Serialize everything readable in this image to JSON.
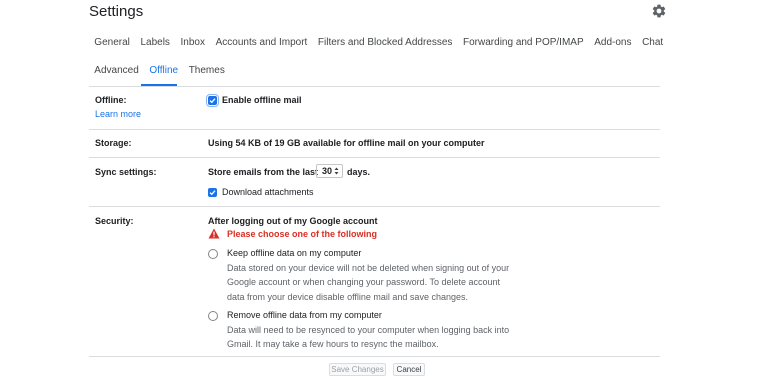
{
  "page": {
    "title": "Settings"
  },
  "tabs_row1": [
    "General",
    "Labels",
    "Inbox",
    "Accounts and Import",
    "Filters and Blocked Addresses",
    "Forwarding and POP/IMAP",
    "Add-ons",
    "Chat"
  ],
  "tabs_row2": [
    "Advanced",
    "Offline",
    "Themes"
  ],
  "active_tab": "Offline",
  "offline": {
    "label": "Offline:",
    "learn_more": "Learn more",
    "enable_label": "Enable offline mail",
    "enable_checked": true
  },
  "storage": {
    "label": "Storage:",
    "text": "Using 54 KB of 19 GB available for offline mail on your computer"
  },
  "sync": {
    "label": "Sync settings:",
    "prefix": "Store emails from the last",
    "days_value": "30",
    "suffix": "days.",
    "download_label": "Download attachments",
    "download_checked": true
  },
  "security": {
    "label": "Security:",
    "heading": "After logging out of my Google account",
    "warning": "Please choose one of the following",
    "option_keep": {
      "label": "Keep offline data on my computer",
      "desc": [
        "Data stored on your device will not be deleted when signing out of your",
        "Google account or when changing your password. To delete account",
        "data from your device disable offline mail and save changes."
      ]
    },
    "option_remove": {
      "label": "Remove offline data from my computer",
      "desc": [
        "Data will need to be resynced to your computer when logging back into",
        "Gmail. It may take a few hours to resync the mailbox."
      ]
    }
  },
  "buttons": {
    "save": "Save Changes",
    "cancel": "Cancel"
  },
  "icons": {
    "settings": "gear-icon",
    "warning": "warning-icon",
    "check": "check-icon",
    "dropdown": "dropdown-arrow-icon"
  },
  "colors": {
    "accent": "#1a73e8",
    "warning": "#d93025",
    "divider": "#dadce0"
  }
}
